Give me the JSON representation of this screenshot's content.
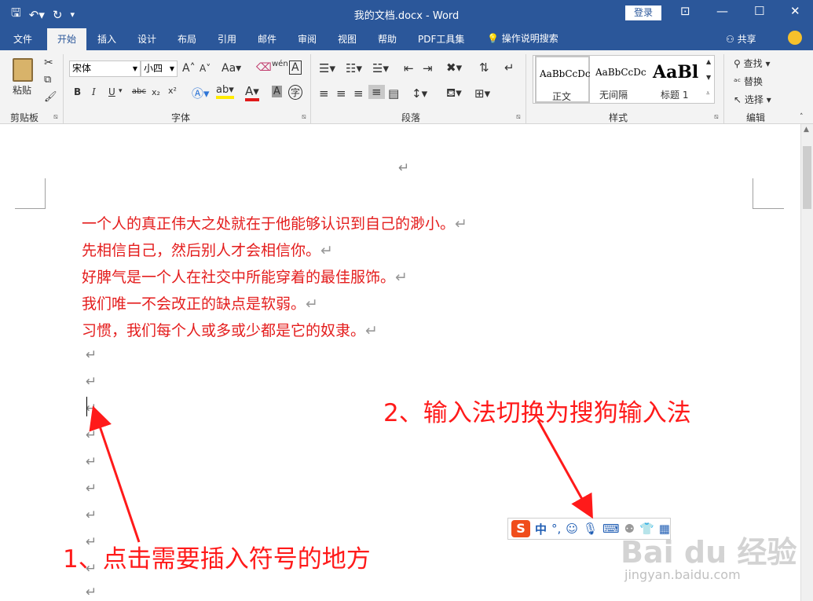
{
  "titlebar": {
    "doc_title": "我的文档.docx  -  Word",
    "login_label": "登录",
    "qat_icons": [
      "save-icon",
      "undo-icon",
      "redo-icon",
      "customize-icon"
    ],
    "window_controls": [
      "ribbon-display-icon",
      "minimize-icon",
      "maximize-icon",
      "close-icon"
    ]
  },
  "tabs": {
    "items": [
      "文件",
      "开始",
      "插入",
      "设计",
      "布局",
      "引用",
      "邮件",
      "审阅",
      "视图",
      "帮助",
      "PDF工具集"
    ],
    "active": "开始",
    "tell_me": "操作说明搜索",
    "share": "共享"
  },
  "ribbon": {
    "clipboard": {
      "paste_label": "粘贴",
      "group_label": "剪贴板"
    },
    "font": {
      "font_name": "宋体",
      "font_size": "小四",
      "group_label": "字体",
      "bold": "B",
      "italic": "I",
      "underline": "U",
      "strike": "abc",
      "subscript": "x₂",
      "superscript": "x²",
      "change_case": "Aa",
      "grow": "A",
      "shrink": "A",
      "phonetic": "wén",
      "border": "A",
      "char_shade": "A",
      "enclose": "字"
    },
    "paragraph": {
      "group_label": "段落"
    },
    "styles": {
      "group_label": "样式",
      "items": [
        {
          "sample": "AaBbCcDc",
          "name": "正文"
        },
        {
          "sample": "AaBbCcDc",
          "name": "无间隔"
        },
        {
          "sample": "AaBl",
          "name": "标题 1"
        }
      ]
    },
    "editing": {
      "group_label": "编辑",
      "find": "查找",
      "replace": "替换",
      "select": "选择"
    }
  },
  "document": {
    "lines": [
      "一个人的真正伟大之处就在于他能够认识到自己的渺小。",
      "先相信自己，然后别人才会相信你。",
      "好脾气是一个人在社交中所能穿着的最佳服饰。",
      "我们唯一不会改正的缺点是软弱。",
      "习惯，我们每个人或多或少都是它的奴隶。"
    ],
    "paragraph_mark": "↵"
  },
  "annotations": {
    "step1": "1、点击需要插入符号的地方",
    "step2": "2、输入法切换为搜狗输入法"
  },
  "ime_toolbar": {
    "logo": "S",
    "mode": "中",
    "punct": "°,",
    "icons": [
      "emoji-icon",
      "microphone-icon",
      "keyboard-icon",
      "user-icon",
      "skin-icon",
      "toolbox-icon"
    ]
  },
  "watermark": {
    "brand": "Bai du 经验",
    "url": "jingyan.baidu.com"
  }
}
